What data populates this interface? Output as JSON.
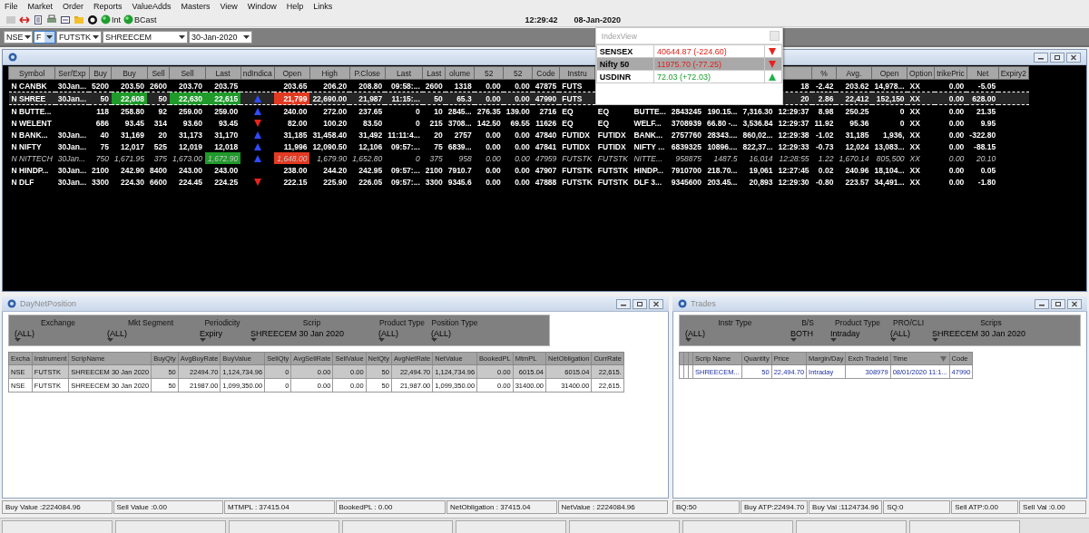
{
  "menu": [
    "File",
    "Market",
    "Order",
    "Reports",
    "ValueAdds",
    "Masters",
    "View",
    "Window",
    "Help",
    "Links"
  ],
  "toolbar": {
    "links": [
      {
        "label": "Int"
      },
      {
        "label": "BCast"
      }
    ],
    "time": "12:29:42",
    "date": "08-Jan-2020"
  },
  "selectors": [
    {
      "value": "NSE",
      "focused": false
    },
    {
      "value": "F",
      "focused": true
    },
    {
      "value": "FUTSTK",
      "focused": false
    },
    {
      "value": "SHREECEM",
      "focused": false
    },
    {
      "value": "30-Jan-2020",
      "focused": false
    }
  ],
  "index_view": {
    "title": "IndexView",
    "rows": [
      {
        "name": "SENSEX",
        "value": "40644.87   (-224.60)",
        "rising": false,
        "selected": false
      },
      {
        "name": "Nifty 50",
        "value": "11975.70   (-77.25)",
        "rising": false,
        "selected": true
      },
      {
        "name": "USDINR",
        "value": "72.03   (+72.03)",
        "rising": true,
        "selected": false
      }
    ]
  },
  "market_watch": {
    "columns": [
      "Symbol",
      "Ser/Exp",
      "Buy",
      "Buy",
      "Sell",
      "Sell",
      "Last",
      "ndIndica",
      "Open",
      "High",
      "P.Close",
      "Last",
      "Last",
      "olume",
      "52",
      "52",
      "Code",
      "Instru",
      null,
      null,
      null,
      null,
      null,
      null,
      "%",
      "Avg.",
      "Open",
      "Option",
      "trikePric",
      "Net",
      "Expiry2"
    ],
    "rows": [
      {
        "selected": false,
        "dimmed": false,
        "rising": false,
        "falling": false,
        "cells": [
          "N CANBK",
          "30Jan...",
          "5200",
          "203.50",
          "2600",
          "203.70",
          "203.75",
          null,
          "203.65",
          "206.20",
          "208.80",
          "09:58:...",
          "2600",
          "1318",
          "0.00",
          "0.00",
          "47875",
          "FUTS",
          null,
          null,
          null,
          null,
          null,
          "18",
          "-2.42",
          "203.62",
          "14,978...",
          "XX",
          "0.00",
          "-5.05"
        ]
      },
      {
        "selected": true,
        "dimmed": false,
        "rising": true,
        "falling": false,
        "cells": [
          "N SHREE",
          "30Jan...",
          "50",
          {
            "text": "22,608",
            "color": "#1f9a2b"
          },
          "50",
          {
            "text": "22,630",
            "color": "#1f9a2b"
          },
          {
            "text": "22,615",
            "color": "#1f9a2b"
          },
          null,
          {
            "text": "21,799",
            "color": "#e23a22"
          },
          "22,690.00",
          "21,987",
          "11:15:...",
          "50",
          "65.3",
          "0.00",
          "0.00",
          "47990",
          "FUTS",
          null,
          null,
          null,
          null,
          null,
          "20",
          "2.86",
          "22,412",
          "152,150",
          "XX",
          "0.00",
          "628.00"
        ]
      },
      {
        "selected": false,
        "dimmed": false,
        "rising": true,
        "falling": false,
        "cells": [
          "N BUTTE...",
          null,
          "118",
          "258.80",
          "92",
          "259.00",
          "259.00",
          null,
          "240.00",
          "272.00",
          "237.65",
          "0",
          "10",
          "2845...",
          "276.35",
          "139.00",
          "2716",
          "EQ",
          "EQ",
          "BUTTE...",
          "2843245",
          "190.15...",
          "7,316.30",
          "12:29:37",
          "8.98",
          "250.25",
          "0",
          "XX",
          "0.00",
          "21.35"
        ]
      },
      {
        "selected": false,
        "dimmed": false,
        "rising": false,
        "falling": true,
        "cells": [
          "N WELENT",
          null,
          "686",
          "93.45",
          "314",
          "93.60",
          "93.45",
          null,
          "82.00",
          "100.20",
          "83.50",
          "0",
          "215",
          "3708...",
          "142.50",
          "69.55",
          "11626",
          "EQ",
          "EQ",
          "WELF...",
          "3708939",
          "66.80 -...",
          "3,536.84",
          "12:29:37",
          "11.92",
          "95.36",
          "0",
          "XX",
          "0.00",
          "9.95"
        ]
      },
      {
        "selected": false,
        "dimmed": false,
        "rising": true,
        "falling": false,
        "cells": [
          "N BANK...",
          "30Jan...",
          "40",
          "31,169",
          "20",
          "31,173",
          "31,170",
          null,
          "31,185",
          "31,458.40",
          "31,492",
          "11:11:4...",
          "20",
          "2757",
          "0.00",
          "0.00",
          "47840",
          "FUTIDX",
          "FUTIDX",
          "BANK...",
          "2757760",
          "28343....",
          "860,02...",
          "12:29:38",
          "-1.02",
          "31,185",
          "1,936,",
          "XX",
          "0.00",
          "-322.80"
        ]
      },
      {
        "selected": false,
        "dimmed": false,
        "rising": true,
        "falling": false,
        "cells": [
          "N NIFTY",
          "30Jan...",
          "75",
          "12,017",
          "525",
          "12,019",
          "12,018",
          null,
          "11,996",
          "12,090.50",
          "12,106",
          "09:57:...",
          "75",
          "6839...",
          "0.00",
          "0.00",
          "47841",
          "FUTIDX",
          "FUTIDX",
          "NIFTY ...",
          "6839325",
          "10896....",
          "822,37...",
          "12:29:33",
          "-0.73",
          "12,024",
          "13,083...",
          "XX",
          "0.00",
          "-88.15"
        ]
      },
      {
        "selected": false,
        "dimmed": true,
        "rising": true,
        "falling": false,
        "cells": [
          "N NITTECH",
          "30Jan...",
          "750",
          "1,671.95",
          "375",
          "1,673.00",
          {
            "text": "1,672.90",
            "color": "#1f9a2b"
          },
          null,
          {
            "text": "1,648.00",
            "color": "#e23a22"
          },
          "1,679.90",
          "1,652.80",
          "0",
          "375",
          "958",
          "0.00",
          "0.00",
          "47959",
          "FUTSTK",
          "FUTSTK",
          "NITTE...",
          "958875",
          "1487.5",
          "16,014",
          "12:28:55",
          "1.22",
          "1,670.14",
          "805,500",
          "XX",
          "0.00",
          "20.10"
        ]
      },
      {
        "selected": false,
        "dimmed": false,
        "rising": false,
        "falling": false,
        "cells": [
          "N HINDP...",
          "30Jan...",
          "2100",
          "242.90",
          "8400",
          "243.00",
          "243.00",
          null,
          "238.00",
          "244.20",
          "242.95",
          "09:57:...",
          "2100",
          "7910.7",
          "0.00",
          "0.00",
          "47907",
          "FUTSTK",
          "FUTSTK",
          "HINDP...",
          "7910700",
          "218.70...",
          "19,061",
          "12:27:45",
          "0.02",
          "240.96",
          "18,104...",
          "XX",
          "0.00",
          "0.05"
        ]
      },
      {
        "selected": false,
        "dimmed": false,
        "rising": false,
        "falling": true,
        "cells": [
          "N DLF",
          "30Jan...",
          "3300",
          "224.30",
          "6600",
          "224.45",
          "224.25",
          null,
          "222.15",
          "225.90",
          "226.05",
          "09:57:...",
          "3300",
          "9345.6",
          "0.00",
          "0.00",
          "47888",
          "FUTSTK",
          "FUTSTK",
          "DLF 3...",
          "9345600",
          "203.45...",
          "20,893",
          "12:29:30",
          "-0.80",
          "223.57",
          "34,491...",
          "XX",
          "0.00",
          "-1.80"
        ]
      }
    ]
  },
  "day_net_position": {
    "title": "DayNetPosition",
    "filters": [
      {
        "label": "Exchange",
        "value": "(ALL)"
      },
      {
        "label": "Mkt Segment",
        "value": "(ALL)"
      },
      {
        "label": "Periodicity",
        "value": "Expiry"
      },
      {
        "label": "Scrip",
        "value": "SHREECEM 30 Jan 2020"
      },
      {
        "label": "Product Type",
        "value": "(ALL)"
      },
      {
        "label": "Position Type",
        "value": "(ALL)"
      }
    ],
    "columns": [
      "Excha",
      "Instrument",
      "ScripName",
      "BuyQty",
      "AvgBuyRate",
      "BuyValue",
      "SellQty",
      "AvgSellRate",
      "SellValue",
      "NetQty",
      "AvgNetRate",
      "NetValue",
      "BookedPL",
      "MtmPL",
      "NetObligation",
      "CurrRate"
    ],
    "rows": [
      {
        "selected": true,
        "cells": [
          "NSE",
          "FUTSTK",
          "SHREECEM 30 Jan 2020",
          "50",
          "22494.70",
          "1,124,734.96",
          "0",
          "0.00",
          "0.00",
          "50",
          "22,494.70",
          "1,124,734.96",
          "0.00",
          "6015.04",
          "6015.04",
          "22,615."
        ]
      },
      {
        "selected": false,
        "cells": [
          "NSE",
          "FUTSTK",
          "SHREECEM 30 Jan 2020",
          "50",
          "21987.00",
          "1,099,350.00",
          "0",
          "0.00",
          "0.00",
          "50",
          "21,987.00",
          "1,099,350.00",
          "0.00",
          "31400.00",
          "31400.00",
          "22,615."
        ]
      }
    ],
    "status": [
      "Buy Value :2224084.96",
      "Sell Value :0.00",
      "MTMPL : 37415.04",
      "BookedPL : 0.00",
      "NetObligation : 37415.04",
      "NetValue : 2224084.96"
    ]
  },
  "trades": {
    "title": "Trades",
    "filters": [
      {
        "label": "Instr Type",
        "value": "(ALL)"
      },
      {
        "label": "B/S",
        "value": "BOTH"
      },
      {
        "label": "Product Type",
        "value": "Intraday"
      },
      {
        "label": "PRO/CLI",
        "value": "(ALL)"
      },
      {
        "label": "Scrips",
        "value": "SHREECEM 30 Jan 2020"
      }
    ],
    "columns": [
      "Scrip Name",
      "Quantity",
      "Price",
      "Margin/Day",
      "Exch TradeId",
      "Time",
      "Code"
    ],
    "rows": [
      {
        "cells": [
          "SHREECEM...",
          "50",
          "22,494.70",
          "Intraday",
          "308979",
          "08/01/2020 11:1...",
          "47990"
        ]
      }
    ],
    "status": [
      "BQ:50",
      "Buy ATP:22494.70",
      "Buy Val :1124734.96",
      "SQ:0",
      "Sell ATP:0.00",
      "Sell Val :0.00"
    ]
  }
}
